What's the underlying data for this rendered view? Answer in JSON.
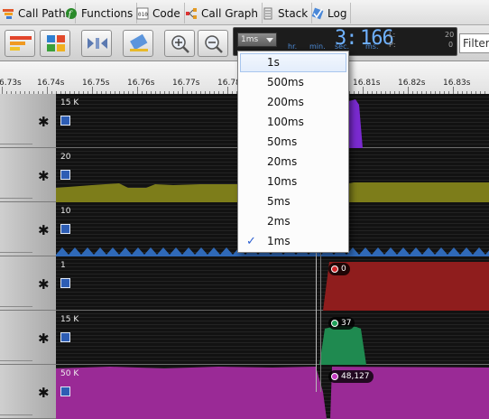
{
  "tabs": [
    {
      "label": "Call Paths",
      "icon": "call-paths-icon"
    },
    {
      "label": "Functions",
      "icon": "functions-icon"
    },
    {
      "label": "Code",
      "icon": "code-icon"
    },
    {
      "label": "Call Graph",
      "icon": "call-graph-icon"
    },
    {
      "label": "Stack",
      "icon": "stack-icon"
    },
    {
      "label": "Log",
      "icon": "log-icon"
    }
  ],
  "toolbar": {
    "interval_value": "1ms",
    "clock": {
      "value_main": "3:",
      "value_digits": "166",
      "labels": [
        "hr.",
        "min.",
        "sec.",
        "ms."
      ],
      "side_labels": [
        "L:",
        "P:"
      ],
      "side_values": [
        "20",
        "0"
      ]
    },
    "filter_label": "Filter"
  },
  "ruler": {
    "labels": [
      "6.73s",
      "16.74s",
      "16.75s",
      "16.76s",
      "16.77s",
      "16.78",
      "16.81s",
      "16.82s",
      "16.83s"
    ]
  },
  "tracks": [
    {
      "scale": "15 K",
      "color": "#7a2ad0"
    },
    {
      "scale": "20",
      "color": "#7a7a1a"
    },
    {
      "scale": "10",
      "color": "#2f69b8"
    },
    {
      "scale": "1",
      "color": "#8f1d1d",
      "badge": "0",
      "badge_color": "#d0262a"
    },
    {
      "scale": "15 K",
      "color": "#1f8a50",
      "badge": "37",
      "badge_color": "#20a25a"
    },
    {
      "scale": "50 K",
      "color": "#9a2a96",
      "badge": "48,127",
      "badge_color": "#c43ac0"
    }
  ],
  "interval_menu": {
    "options": [
      "1s",
      "500ms",
      "200ms",
      "100ms",
      "50ms",
      "20ms",
      "10ms",
      "5ms",
      "2ms",
      "1ms"
    ],
    "highlighted": "1s",
    "selected": "1ms"
  },
  "colors": {
    "accent_blue": "#2d5db4",
    "clock_blue": "#6fb1ff"
  }
}
